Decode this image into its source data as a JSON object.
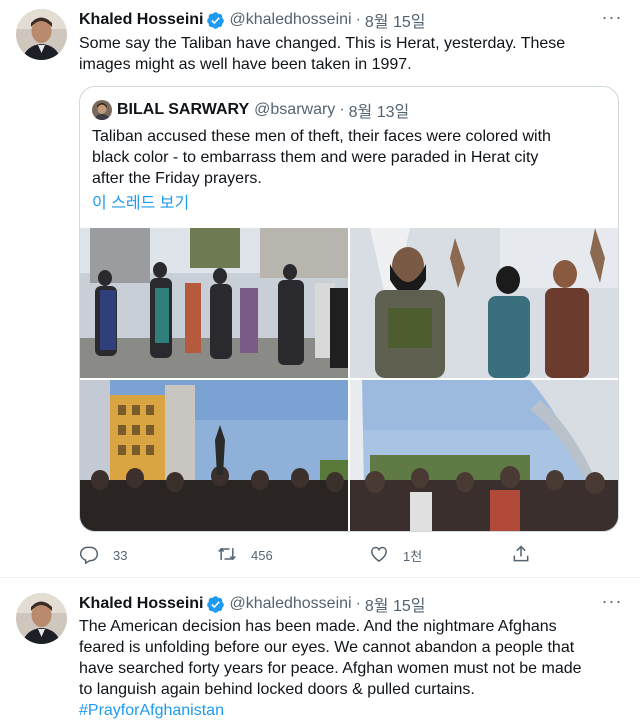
{
  "tweets": [
    {
      "author": "Khaled Hosseini",
      "handle": "@khaledhosseini",
      "separator": "·",
      "date": "8월 15일",
      "more": "···",
      "lines": [
        "Some say the Taliban have changed. This is Herat, yesterday. These",
        "images might as well have been taken in 1997."
      ],
      "quote": {
        "author": "BILAL SARWARY",
        "handle": "@bsarwary",
        "separator": "·",
        "date": "8월 13일",
        "lines": [
          "Taliban accused these men of theft, their faces were colored with",
          "black color - to embarrass them and were paraded in Herat city",
          "after the Friday prayers."
        ],
        "thread_link": "이 스레드 보기",
        "media_count": 4
      },
      "actions": {
        "reply_count": "33",
        "retweet_count": "456",
        "like_count": "1천",
        "share_count": ""
      }
    },
    {
      "author": "Khaled Hosseini",
      "handle": "@khaledhosseini",
      "separator": "·",
      "date": "8월 15일",
      "more": "···",
      "lines": [
        "The American decision has been made. And the nightmare Afghans",
        "feared is unfolding before our eyes. We cannot abandon a people that",
        "have searched forty years for peace. Afghan women must not be made",
        "to languish again behind locked doors & pulled curtains."
      ],
      "hashtag": "#PrayforAfghanistan"
    }
  ],
  "colors": {
    "text": "#0f1419",
    "secondary": "#536471",
    "link": "#1d9bf0",
    "verified": "#1d9bf0",
    "border": "#cfd9de"
  },
  "icons": {
    "reply": "reply-icon",
    "retweet": "retweet-icon",
    "like": "like-icon",
    "share": "share-icon",
    "verified": "verified-badge-icon",
    "more": "more-icon"
  }
}
